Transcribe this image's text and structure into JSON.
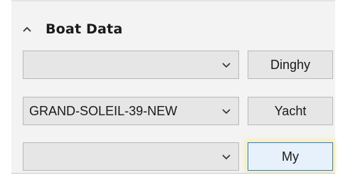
{
  "panel": {
    "title": "Boat Data",
    "collapse_icon": "chevron-up-icon"
  },
  "rows": [
    {
      "combo_value": "",
      "dropdown_icon": "chevron-down-icon",
      "button_label": "Dinghy"
    },
    {
      "combo_value": "GRAND-SOLEIL-39-NEW",
      "dropdown_icon": "chevron-down-icon",
      "button_label": "Yacht"
    },
    {
      "combo_value": "",
      "dropdown_icon": "chevron-down-icon",
      "button_label": "My"
    }
  ],
  "colors": {
    "panel_background": "#f3f3f3",
    "control_background": "#e6e6e6",
    "control_border": "#b9b9b9",
    "focus_border": "#2a7fd6",
    "focus_glow": "#ffec8c"
  }
}
